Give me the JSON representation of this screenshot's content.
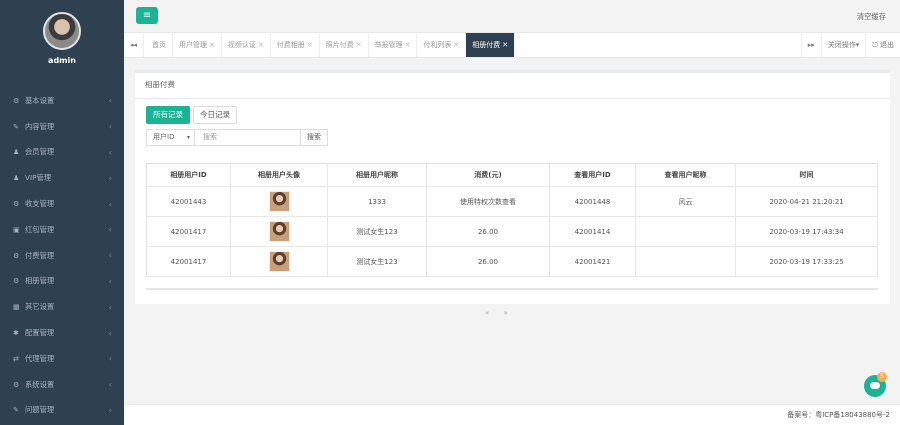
{
  "user": {
    "name": "admin"
  },
  "menu": [
    {
      "icon": "⚙",
      "label": "基本设置"
    },
    {
      "icon": "✎",
      "label": "内容管理"
    },
    {
      "icon": "♟",
      "label": "会员管理"
    },
    {
      "icon": "♟",
      "label": "VIP管理"
    },
    {
      "icon": "⚙",
      "label": "收支管理"
    },
    {
      "icon": "▣",
      "label": "红包管理"
    },
    {
      "icon": "⚙",
      "label": "付费管理"
    },
    {
      "icon": "⚙",
      "label": "相册管理"
    },
    {
      "icon": "▦",
      "label": "其它设置"
    },
    {
      "icon": "✱",
      "label": "配置管理"
    },
    {
      "icon": "⇄",
      "label": "代理管理"
    },
    {
      "icon": "⚙",
      "label": "系统设置"
    },
    {
      "icon": "✎",
      "label": "问题管理"
    }
  ],
  "topbar": {
    "menu_toggle": "≡",
    "clear_cache": "清空缓存"
  },
  "tabs": {
    "prev": "◂◂",
    "next": "▸▸",
    "close_x": "✕",
    "items": [
      {
        "label": "首页"
      },
      {
        "label": "用户管理"
      },
      {
        "label": "视频认证"
      },
      {
        "label": "付费相册"
      },
      {
        "label": "照片付费"
      },
      {
        "label": "举报管理"
      },
      {
        "label": "付利列表"
      },
      {
        "label": "相册付费"
      }
    ],
    "close_ops": "关闭操作▾",
    "logout": "⎋ 退出"
  },
  "panel": {
    "title": "相册付费",
    "btn_all": "所有记录",
    "btn_today": "今日记录",
    "filter_select": "用户ID",
    "filter_caret": "▾",
    "search_placeholder": "搜索",
    "search_button": "搜索"
  },
  "table": {
    "headers": [
      "相册用户ID",
      "相册用户头像",
      "相册用户昵称",
      "消费(元)",
      "查看用户ID",
      "查看用户昵称",
      "时间"
    ],
    "rows": [
      [
        "42001443",
        "",
        "1333",
        "使用特权次数查看",
        "42001448",
        "风云",
        "2020-04-21 21:20:21"
      ],
      [
        "42001417",
        "",
        "测试女生123",
        "26.00",
        "42001414",
        "",
        "2020-03-19 17:43:34"
      ],
      [
        "42001417",
        "",
        "测试女生123",
        "26.00",
        "42001421",
        "",
        "2020-03-19 17:33:25"
      ]
    ]
  },
  "pager": "« »",
  "footer": {
    "icp": "备案号：粤ICP备18043880号-2"
  },
  "chat": {
    "badge": "5"
  }
}
